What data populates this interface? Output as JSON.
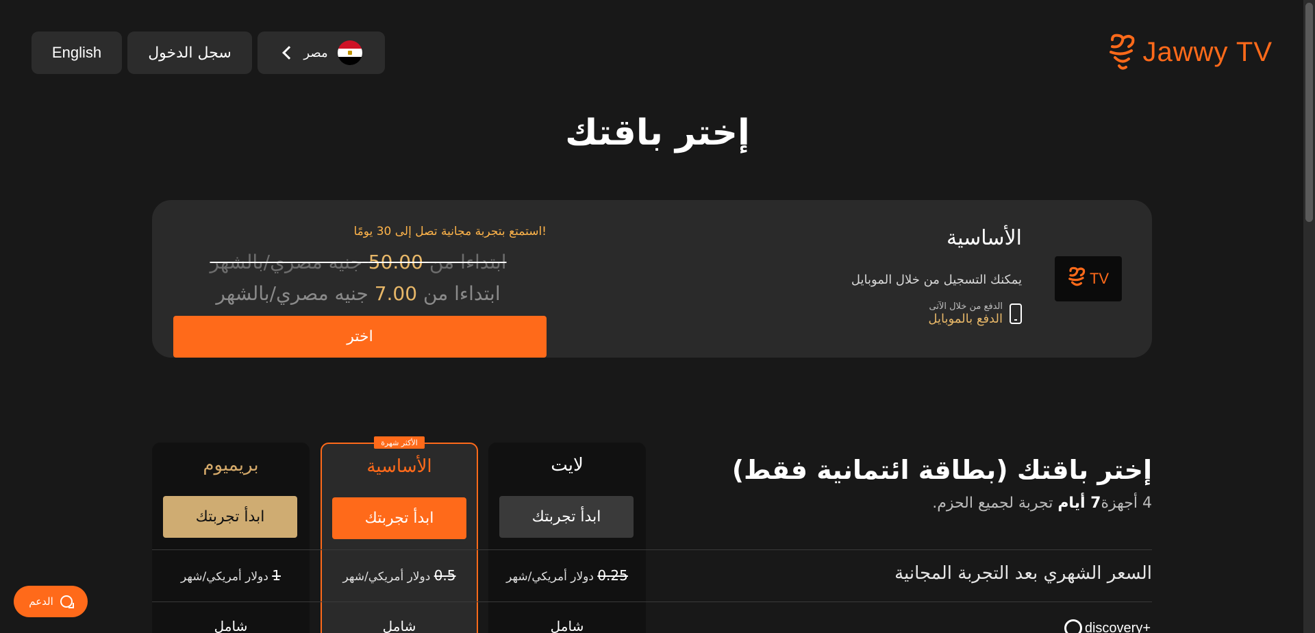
{
  "header": {
    "english_label": "English",
    "login_label": "سجل الدخول",
    "country_label": "مصر",
    "logo_text": "Jawwy TV"
  },
  "page_title": "إختر باقتك",
  "featured": {
    "plan_name": "الأساسية",
    "badge_text": "TV",
    "register_text": "يمكنك التسجيل من خلال الموبايل",
    "pay_small": "الدفع من خلال الآتى",
    "pay_main": "الدفع بالموبايل",
    "trial_note": "استمتع بتجربة مجانية تصل إلى 30 يومًا!",
    "old_price_prefix": "ابتداءا من",
    "old_price_value": "50.00",
    "old_price_suffix": "جنيه مصري/بالشهر",
    "new_price_prefix": "ابتداءا من",
    "new_price_value": "7.00",
    "new_price_suffix": "جنيه مصري/بالشهر",
    "choose_label": "اختر"
  },
  "plans": {
    "title": "إختر باقتك (بطاقة ائتمانية فقط)",
    "subtitle_devices": "4 أجهزة",
    "subtitle_days": "7 أيام",
    "subtitle_rest": "تجربة لجميع الحزم.",
    "popular_tag": "الأكثر شهرة",
    "columns": [
      {
        "name": "بريميوم",
        "button": "ابدأ تجربتك",
        "price": "1",
        "price_unit": "دولار أمريكي/شهر",
        "included": "شامل"
      },
      {
        "name": "الأساسية",
        "button": "ابدأ تجربتك",
        "price": "0.5",
        "price_unit": "دولار أمريكي/شهر",
        "included": "شامل"
      },
      {
        "name": "لايت",
        "button": "ابدأ تجربتك",
        "price": "0.25",
        "price_unit": "دولار أمريكي/شهر",
        "included": "شامل"
      }
    ],
    "monthly_price_label": "السعر الشهري بعد التجربة المجانية",
    "discovery_label": "discovery+"
  },
  "support_label": "الدعم",
  "colors": {
    "accent": "#ff6a1a",
    "gold": "#cfac72",
    "background": "#181818",
    "card": "#2a2a2a"
  }
}
